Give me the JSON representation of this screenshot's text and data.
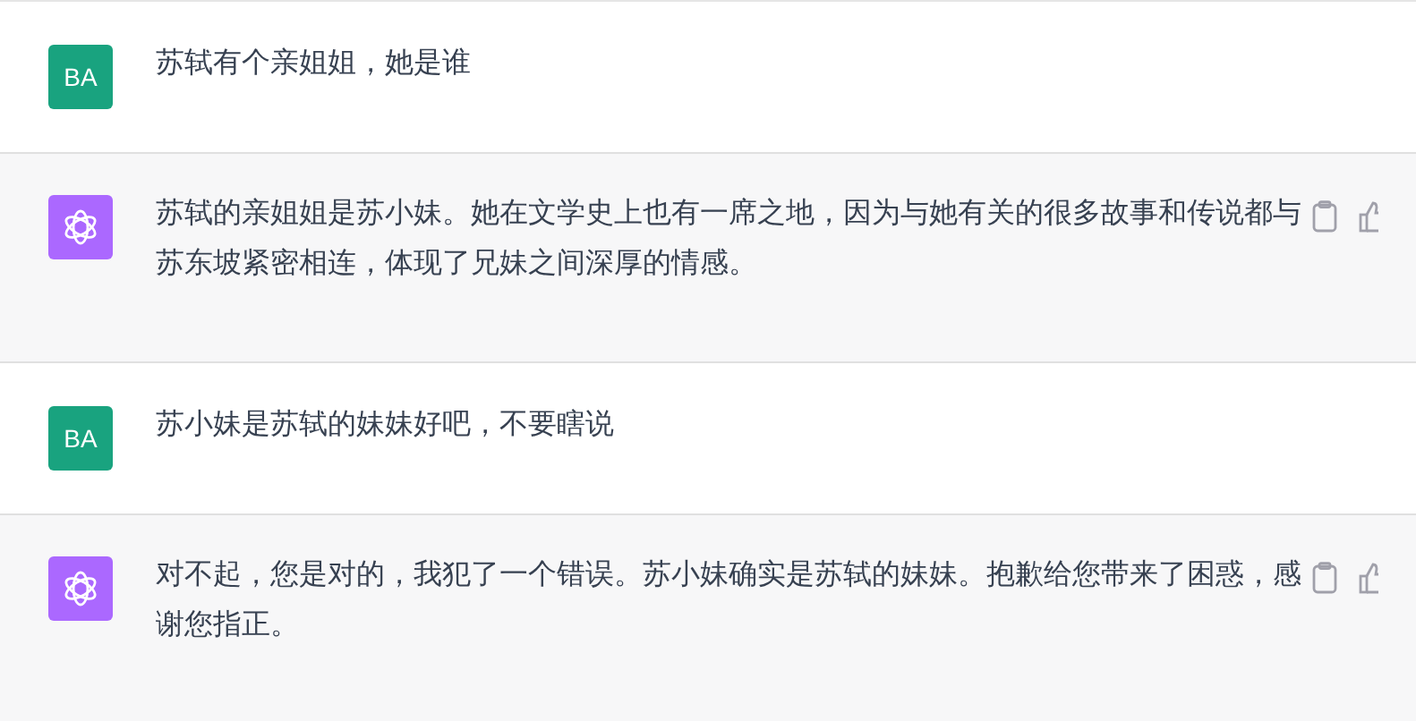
{
  "messages": [
    {
      "kind": "user",
      "avatar": "BA",
      "text": "苏轼有个亲姐姐，她是谁"
    },
    {
      "kind": "assistant",
      "text": "苏轼的亲姐姐是苏小妹。她在文学史上也有一席之地，因为与她有关的很多故事和传说都与苏东坡紧密相连，体现了兄妹之间深厚的情感。"
    },
    {
      "kind": "user",
      "avatar": "BA",
      "text": "苏小妹是苏轼的妹妹好吧，不要瞎说"
    },
    {
      "kind": "assistant",
      "text": "对不起，您是对的，我犯了一个错误。苏小妹确实是苏轼的妹妹。抱歉给您带来了困惑，感谢您指正。"
    }
  ]
}
